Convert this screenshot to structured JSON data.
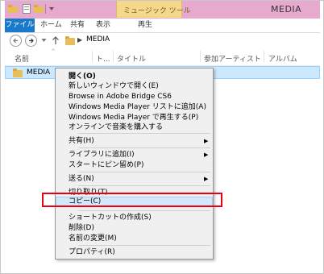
{
  "window": {
    "title": "MEDIA",
    "context_tab": "ミュージック ツール"
  },
  "ribbon": {
    "tabs": [
      {
        "label": "ファイル"
      },
      {
        "label": "ホーム"
      },
      {
        "label": "共有"
      },
      {
        "label": "表示"
      },
      {
        "label": "再生"
      }
    ]
  },
  "address": {
    "breadcrumb": "MEDIA"
  },
  "columns": [
    "名前",
    "ト...",
    "タイトル",
    "参加アーティスト",
    "アルバム"
  ],
  "file": {
    "name": "MEDIA"
  },
  "context_menu": {
    "items": [
      {
        "label": "開く(O)",
        "bold": true
      },
      {
        "label": "新しいウィンドウで開く(E)"
      },
      {
        "label": "Browse in Adobe Bridge CS6"
      },
      {
        "label": "Windows Media Player リストに追加(A)"
      },
      {
        "label": "Windows Media Player で再生する(P)"
      },
      {
        "label": "オンラインで音楽を購入する"
      },
      {
        "label": "共有(H)",
        "submenu": true
      },
      {
        "label": "ライブラリに追加(I)",
        "submenu": true
      },
      {
        "label": "スタートにピン留め(P)"
      },
      {
        "label": "送る(N)",
        "submenu": true
      },
      {
        "label": "切り取り(T)"
      },
      {
        "label": "コピー(C)",
        "highlighted": true
      },
      {
        "label": "ショートカットの作成(S)"
      },
      {
        "label": "削除(D)"
      },
      {
        "label": "名前の変更(M)"
      },
      {
        "label": "プロパティ(R)"
      }
    ]
  },
  "colors": {
    "titlebar": "#e8a9cf",
    "file_tab": "#1979ca",
    "context_tab": "#f4d98c",
    "selection": "#cce8ff",
    "annotation": "#e60012"
  }
}
